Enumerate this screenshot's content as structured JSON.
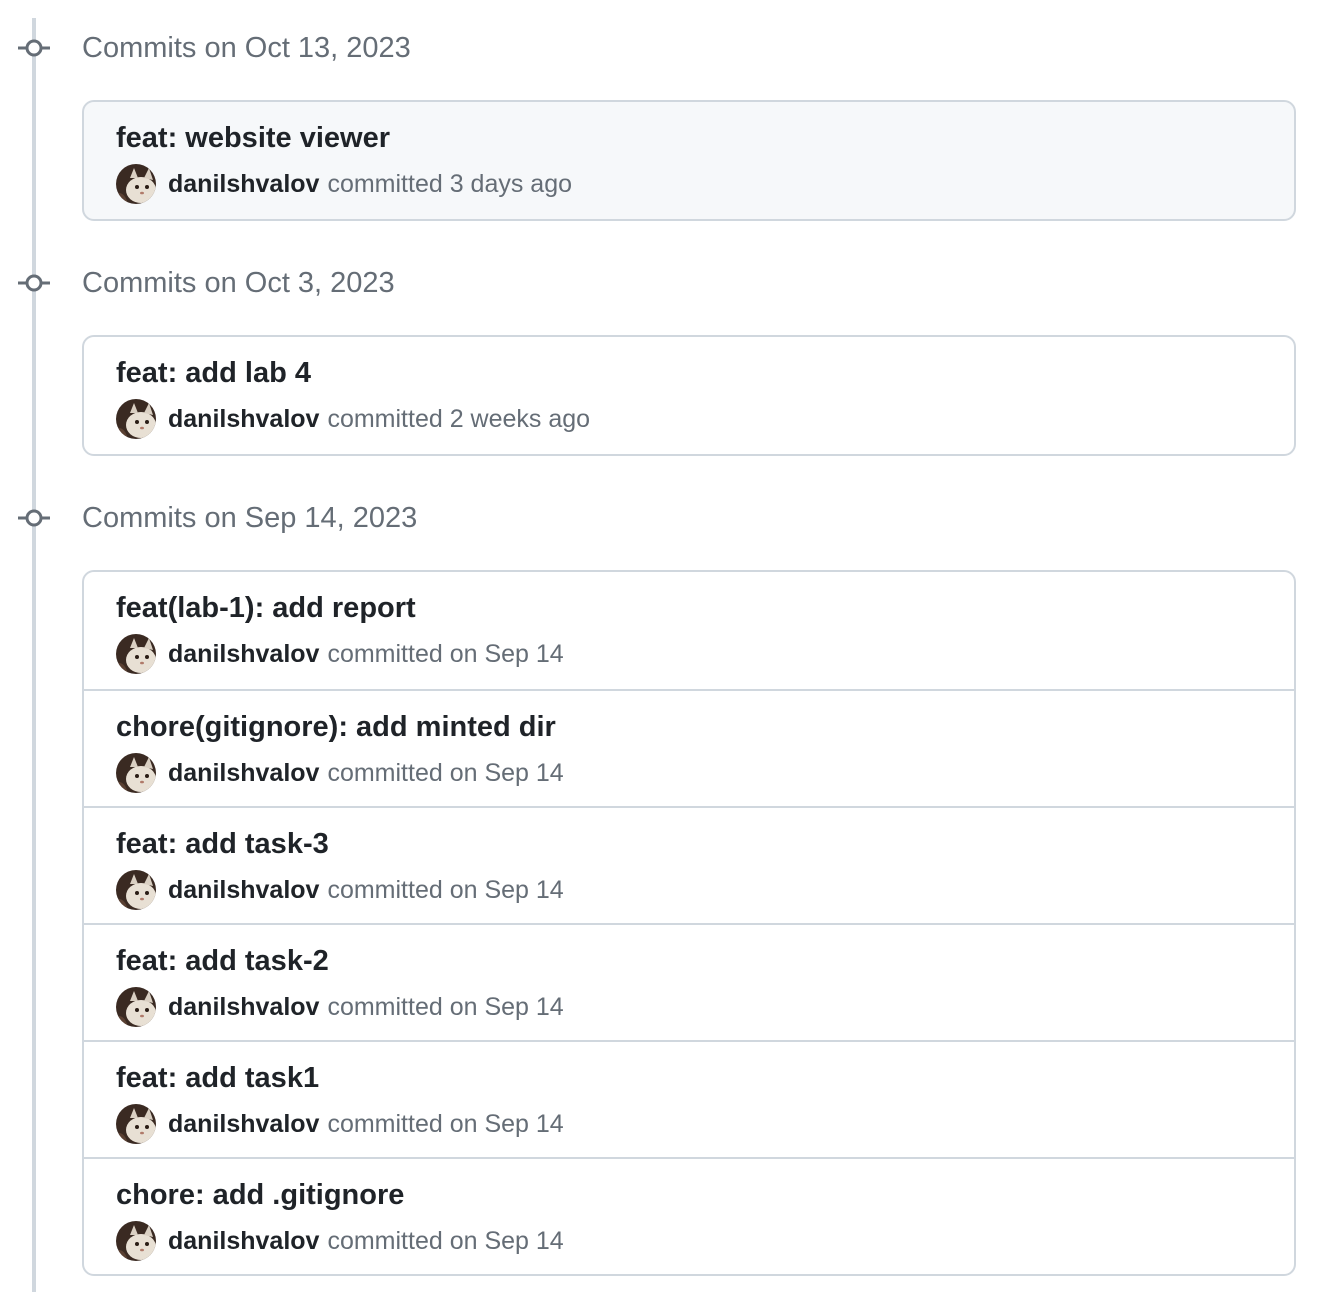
{
  "groups": [
    {
      "title": "Commits on Oct 13, 2023",
      "commits": [
        {
          "message": "feat: website viewer",
          "author": "danilshvalov",
          "time": "committed 3 days ago"
        }
      ]
    },
    {
      "title": "Commits on Oct 3, 2023",
      "commits": [
        {
          "message": "feat: add lab 4",
          "author": "danilshvalov",
          "time": "committed 2 weeks ago"
        }
      ]
    },
    {
      "title": "Commits on Sep 14, 2023",
      "commits": [
        {
          "message": "feat(lab-1): add report",
          "author": "danilshvalov",
          "time": "committed on Sep 14"
        },
        {
          "message": "chore(gitignore): add minted dir",
          "author": "danilshvalov",
          "time": "committed on Sep 14"
        },
        {
          "message": "feat: add task-3",
          "author": "danilshvalov",
          "time": "committed on Sep 14"
        },
        {
          "message": "feat: add task-2",
          "author": "danilshvalov",
          "time": "committed on Sep 14"
        },
        {
          "message": "feat: add task1",
          "author": "danilshvalov",
          "time": "committed on Sep 14"
        },
        {
          "message": "chore: add .gitignore",
          "author": "danilshvalov",
          "time": "committed on Sep 14"
        }
      ]
    }
  ],
  "colors": {
    "timeline": "#d0d7de",
    "muted_text": "#656d76",
    "primary_text": "#1f2328",
    "border": "#d0d7de",
    "highlight_bg": "#f6f8fa"
  },
  "icons": {
    "group_node": "git-commit-icon",
    "avatar": "cat-avatar-icon"
  }
}
